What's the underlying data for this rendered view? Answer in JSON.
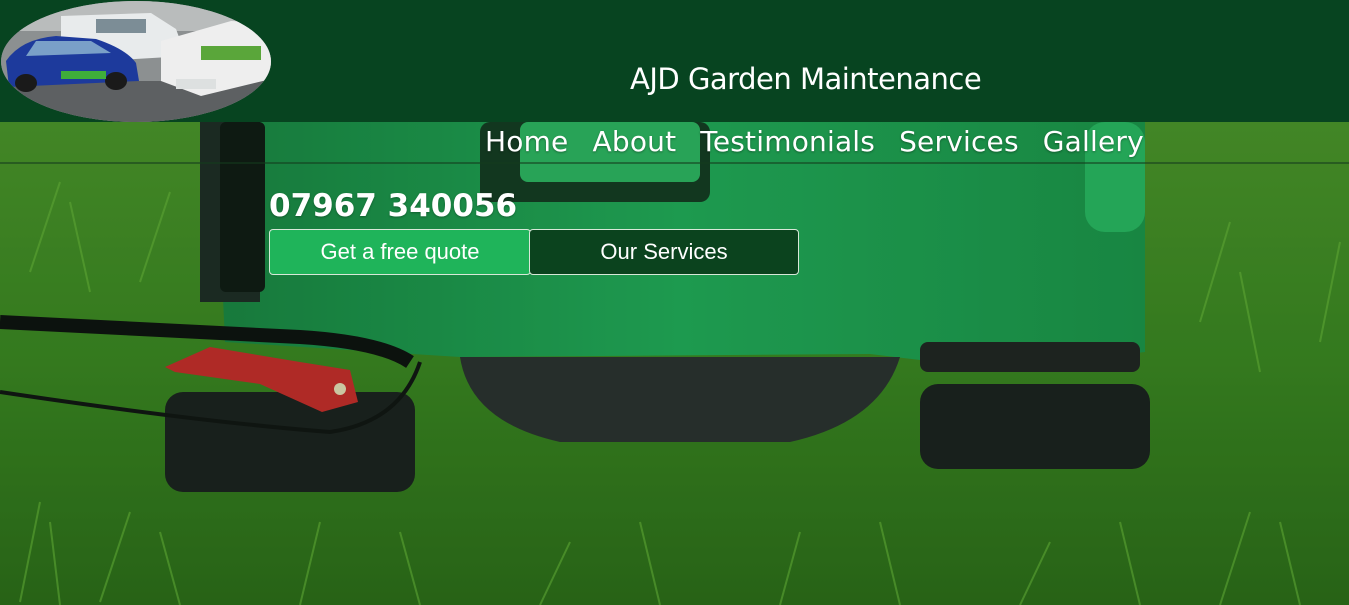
{
  "header": {
    "title": "AJD Garden Maintenance",
    "logo_alt": "logo-vans-photo"
  },
  "nav": {
    "items": [
      {
        "label": "Home"
      },
      {
        "label": "About"
      },
      {
        "label": "Testimonials"
      },
      {
        "label": "Services"
      },
      {
        "label": "Gallery"
      }
    ]
  },
  "hero": {
    "phone": "07967 340056",
    "quote_button": "Get a free quote",
    "services_button": "Our Services",
    "image": "lawnmower-on-grass"
  },
  "colors": {
    "header_bg": "#074420",
    "quote_button_bg": "#1fb45a",
    "services_button_bg": "#0b431e",
    "mower_green": "#1fa552"
  }
}
